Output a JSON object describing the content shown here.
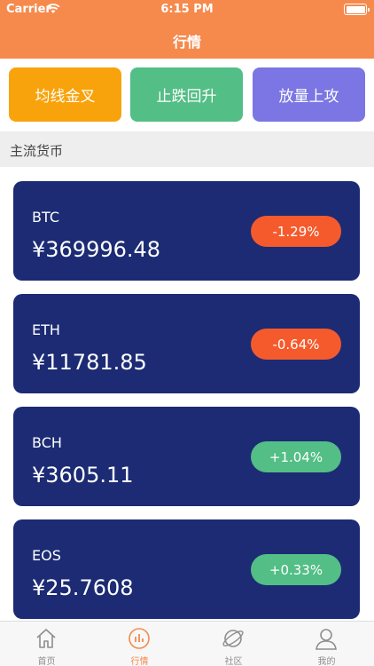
{
  "status": {
    "carrier": "Carrier",
    "time": "6:15 PM"
  },
  "nav": {
    "title": "行情"
  },
  "strategies": [
    {
      "label": "均线金叉",
      "color": "#f8a30b"
    },
    {
      "label": "止跌回升",
      "color": "#53be85"
    },
    {
      "label": "放量上攻",
      "color": "#7b76e3"
    }
  ],
  "section": {
    "title": "主流货币"
  },
  "coins": [
    {
      "name": "BTC",
      "price": "¥369996.48",
      "change": "-1.29%",
      "trend": "down"
    },
    {
      "name": "ETH",
      "price": "¥11781.85",
      "change": "-0.64%",
      "trend": "down"
    },
    {
      "name": "BCH",
      "price": "¥3605.11",
      "change": "+1.04%",
      "trend": "up"
    },
    {
      "name": "EOS",
      "price": "¥25.7608",
      "change": "+0.33%",
      "trend": "up"
    }
  ],
  "colors": {
    "header": "#f58a4c",
    "card": "#1c2b74",
    "down": "#f55a2c",
    "up": "#53be85"
  },
  "tabs": [
    {
      "label": "首页",
      "icon": "home-icon"
    },
    {
      "label": "行情",
      "icon": "chart-icon",
      "active": true
    },
    {
      "label": "社区",
      "icon": "planet-icon"
    },
    {
      "label": "我的",
      "icon": "user-icon"
    }
  ]
}
